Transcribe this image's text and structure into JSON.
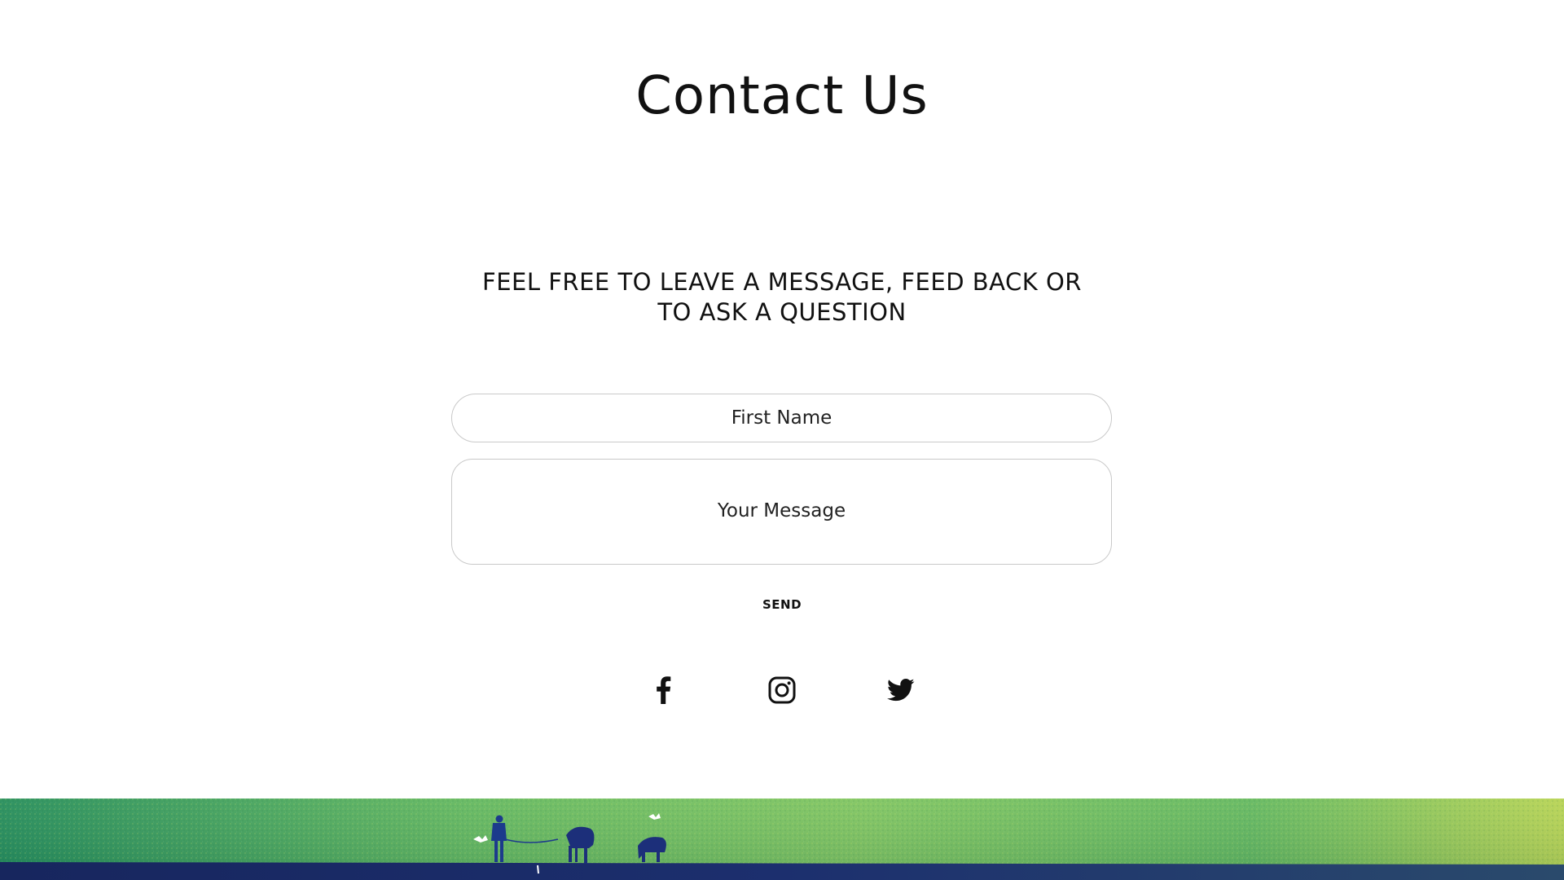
{
  "header": {
    "title": "Contact Us"
  },
  "intro": {
    "line1": "FEEL FREE TO LEAVE A MESSAGE, FEED BACK OR",
    "line2": "TO ASK A QUESTION"
  },
  "form": {
    "first_name_placeholder": "First Name",
    "message_placeholder": "Your Message",
    "send_label": "SEND"
  },
  "social": {
    "icons": [
      "facebook-icon",
      "instagram-icon",
      "twitter-icon"
    ]
  },
  "colors": {
    "text": "#111111",
    "field_border": "#c9c9c9",
    "banner_green": "#5fb65a",
    "banner_lime": "#b5d24e",
    "banner_navy": "#1c2f6e"
  }
}
